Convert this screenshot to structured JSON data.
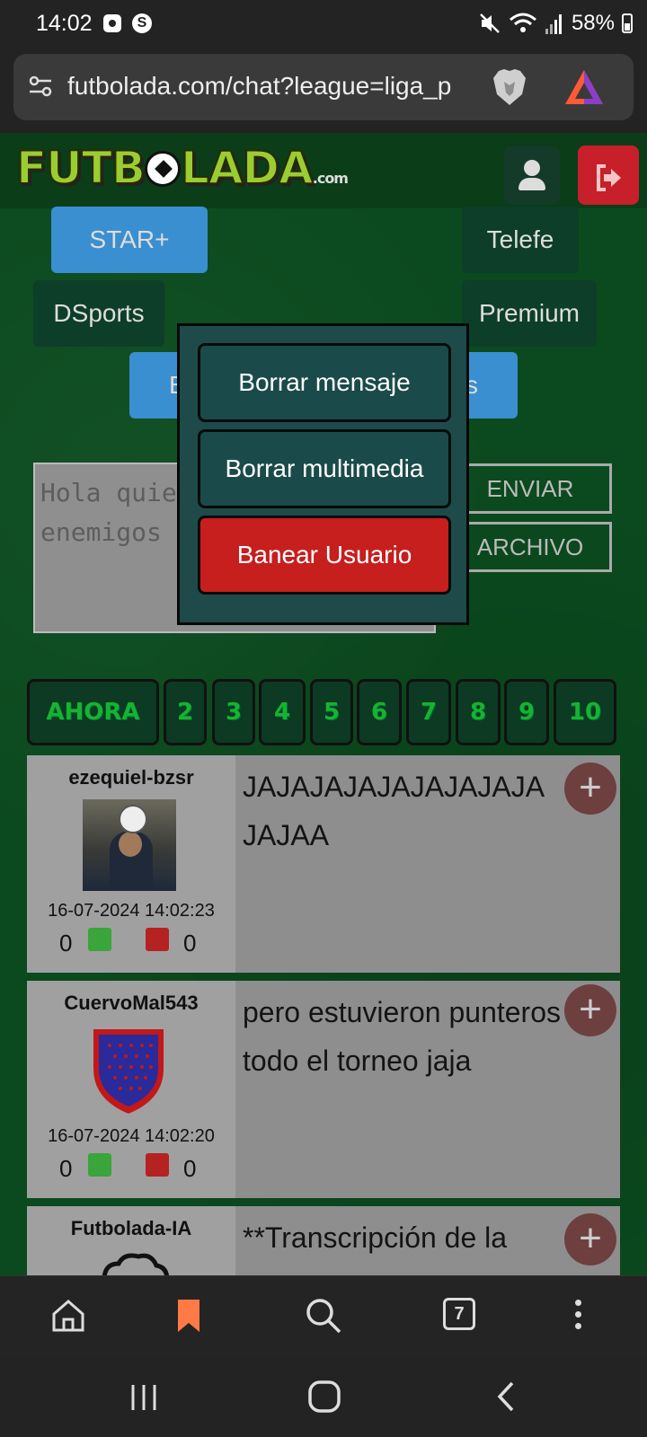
{
  "status_bar": {
    "time": "14:02",
    "battery": "58%"
  },
  "browser": {
    "url": "futbolada.com/chat?league=liga_p",
    "tab_count": "7"
  },
  "site": {
    "logo_text_1": "FUTB",
    "logo_text_2": "LADA",
    "logo_suffix": ".com",
    "channels": {
      "star": "STAR+",
      "telefe": "Telefe",
      "dsports": "DSports",
      "premium": "Premium",
      "hidden_left": "E",
      "hidden_right": "s"
    },
    "compose": {
      "placeholder": "Hola quiero hacer enemigos",
      "send_label": "ENVIAR",
      "file_label": "ARCHIVO"
    },
    "pages": [
      "AHORA",
      "2",
      "3",
      "4",
      "5",
      "6",
      "7",
      "8",
      "9",
      "10"
    ],
    "messages": [
      {
        "user": "ezequiel-bzsr",
        "date": "16-07-2024 14:02:23",
        "likes": "0",
        "dislikes": "0",
        "line1": "JAJAJAJAJAJAJAJAJA",
        "line2": "JAJAA"
      },
      {
        "user": "CuervoMal543",
        "date": "16-07-2024 14:02:20",
        "likes": "0",
        "dislikes": "0",
        "line1": "pero estuvieron punteros",
        "line2": "todo el torneo jaja"
      },
      {
        "user": "Futbolada-IA",
        "line1": "**Transcripción de la"
      }
    ],
    "plus_label": "+"
  },
  "popup": {
    "delete_message": "Borrar mensaje",
    "delete_media": "Borrar multimedia",
    "ban_user": "Banear Usuario"
  },
  "colors": {
    "page_bg": "#0b4a1e",
    "popup_bg": "#1e4a4a",
    "danger": "#c71e1e",
    "page_tab_text": "#16b332",
    "bookmark_accent": "#ff7a45"
  }
}
